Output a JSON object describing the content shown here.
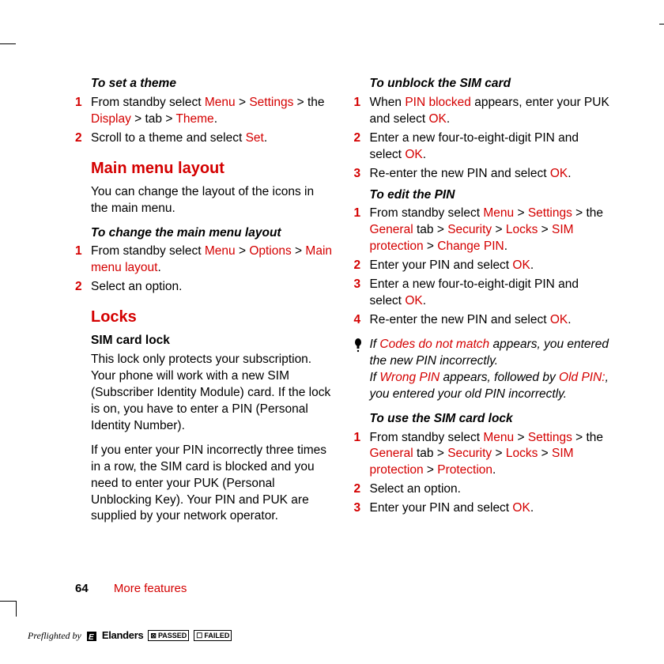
{
  "left": {
    "sub1": "To set a theme",
    "step1a": "From standby select ",
    "step1b": " > ",
    "step1c": " > the ",
    "step1d": " tab > ",
    "step1e": ".",
    "menu": "Menu",
    "settings": "Settings",
    "display": "Display",
    "theme": "Theme",
    "step2": "Scroll to a theme and select ",
    "set": "Set",
    "h_mainmenu": "Main menu layout",
    "mainmenu_body": "You can change the layout of the icons in the main menu.",
    "sub2": "To change the main menu layout",
    "mm_step1a": "From standby select ",
    "mm_step1b": " > ",
    "mm_step1c": " > ",
    "mm_step1d": ".",
    "options": "Options",
    "mainmenulayout": "Main menu layout",
    "mm_step2": "Select an option.",
    "h_locks": "Locks",
    "locks_bold": "SIM card lock",
    "locks_body1": "This lock only protects your subscription. Your phone will work with a new SIM (Subscriber Identity Module) card. If the lock is on, you have to enter a PIN (Personal Identity Number).",
    "locks_body2": "If you enter your PIN incorrectly three times in a row, the SIM card is blocked and you need to enter your PUK (Personal Unblocking Key). Your PIN and PUK are supplied by your network operator."
  },
  "right": {
    "sub1": "To unblock the SIM card",
    "u1a": "When ",
    "pinblocked": "PIN blocked",
    "u1b": " appears, enter your PUK and select ",
    "ok": "OK",
    "u2": "Enter a new four-to-eight-digit PIN and select ",
    "u3": "Re-enter the new PIN and select ",
    "sub2": "To edit the PIN",
    "e1a": "From standby select ",
    "menu": "Menu",
    "settings": "Settings",
    "e1b": " > the ",
    "general": "General",
    "e1c": " tab > ",
    "security": "Security",
    "e1d": " > ",
    "locks": "Locks",
    "e1e": " > ",
    "simprot": "SIM protection",
    "e1f": " > ",
    "changepin": "Change PIN",
    "e2": "Enter your PIN and select ",
    "e3": "Enter a new four-to-eight-digit PIN and select ",
    "e4": "Re-enter the new PIN and select ",
    "note1a": "If ",
    "codesnomatch": "Codes do not match",
    "note1b": " appears, you entered the new PIN incorrectly.",
    "note2a": "If ",
    "wrongpin": "Wrong PIN",
    "note2b": " appears, followed by ",
    "oldpin": "Old PIN:",
    "note2c": ", you entered your old PIN incorrectly.",
    "sub3": "To use the SIM card lock",
    "s1f": " > ",
    "protection": "Protection",
    "s2": "Select an option.",
    "s3": "Enter your PIN and select "
  },
  "footer": {
    "page": "64",
    "section": "More features"
  },
  "preflight": {
    "by": "Preflighted by",
    "brand": "Elanders",
    "passed": "PASSED",
    "failed": "FAILED"
  }
}
